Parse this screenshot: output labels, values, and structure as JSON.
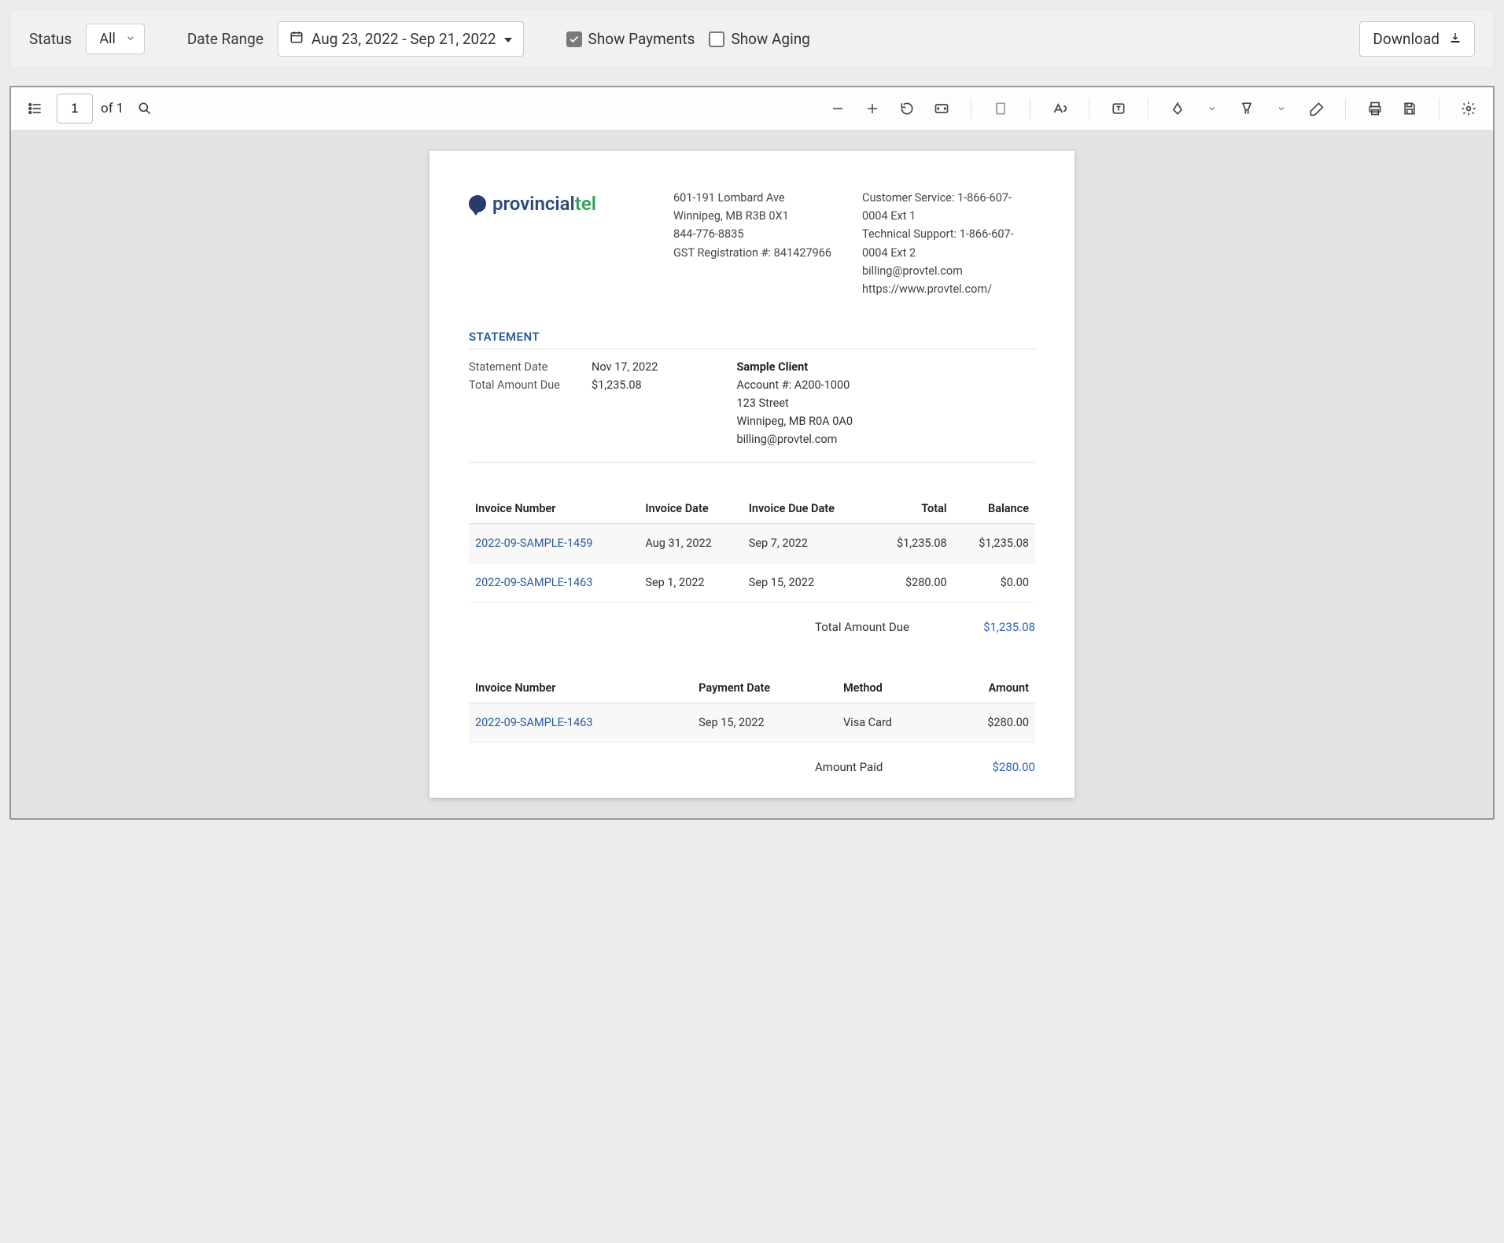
{
  "filters": {
    "status_label": "Status",
    "status_value": "All",
    "date_range_label": "Date Range",
    "date_range_value": "Aug 23, 2022 - Sep 21, 2022",
    "show_payments_label": "Show Payments",
    "show_payments_checked": true,
    "show_aging_label": "Show Aging",
    "show_aging_checked": false,
    "download_label": "Download"
  },
  "viewer": {
    "page_current": "1",
    "page_total_prefix": "of ",
    "page_total": "1"
  },
  "doc": {
    "logo_brand_a": "provincial",
    "logo_brand_b": "tel",
    "company": {
      "address1": "601-191 Lombard Ave",
      "address2": "Winnipeg, MB R3B 0X1",
      "phone": "844-776-8835",
      "gst": "GST Registration #: 841427966"
    },
    "contact": {
      "cust_service": "Customer Service: 1-866-607-0004 Ext 1",
      "tech_support": "Technical Support: 1-866-607-0004 Ext 2",
      "email": "billing@provtel.com",
      "url": "https://www.provtel.com/"
    },
    "statement_title": "STATEMENT",
    "statement_date_label": "Statement Date",
    "statement_date": "Nov 17, 2022",
    "total_due_label": "Total Amount Due",
    "total_due": "$1,235.08",
    "client": {
      "name": "Sample Client",
      "account": "Account #: A200-1000",
      "address1": "123 Street",
      "address2": "Winnipeg, MB R0A 0A0",
      "email": "billing@provtel.com"
    },
    "invoice_headers": {
      "number": "Invoice Number",
      "date": "Invoice Date",
      "due": "Invoice Due Date",
      "total": "Total",
      "balance": "Balance"
    },
    "invoices": [
      {
        "number": "2022-09-SAMPLE-1459",
        "date": "Aug 31, 2022",
        "due": "Sep 7, 2022",
        "total": "$1,235.08",
        "balance": "$1,235.08"
      },
      {
        "number": "2022-09-SAMPLE-1463",
        "date": "Sep 1, 2022",
        "due": "Sep 15, 2022",
        "total": "$280.00",
        "balance": "$0.00"
      }
    ],
    "total_amount_due_label": "Total Amount Due",
    "total_amount_due": "$1,235.08",
    "payment_headers": {
      "number": "Invoice Number",
      "date": "Payment Date",
      "method": "Method",
      "amount": "Amount"
    },
    "payments": [
      {
        "number": "2022-09-SAMPLE-1463",
        "date": "Sep 15, 2022",
        "method": "Visa Card",
        "amount": "$280.00"
      }
    ],
    "amount_paid_label": "Amount Paid",
    "amount_paid": "$280.00"
  }
}
